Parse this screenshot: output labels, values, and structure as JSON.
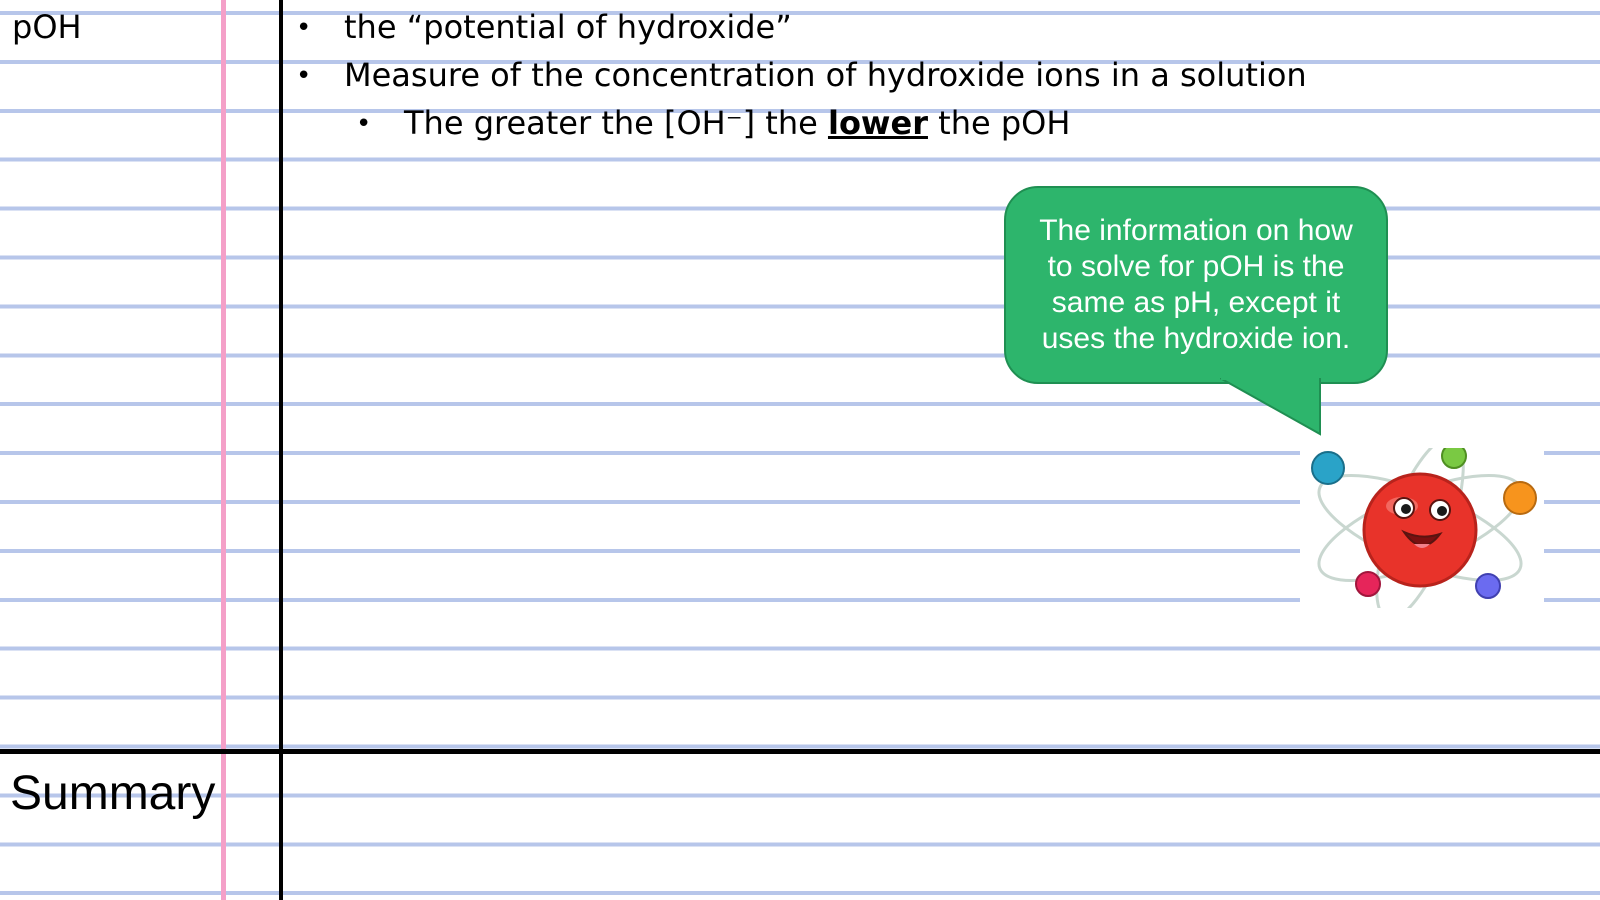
{
  "topic": "pOH",
  "bullets": [
    {
      "text": "the “potential of hydroxide”"
    },
    {
      "text": "Measure of the concentration of hydroxide ions in a solution"
    }
  ],
  "sub_bullet": {
    "prefix": "The greater the [OH⁻] the ",
    "emphasis": "lower",
    "suffix": " the pOH"
  },
  "callout": {
    "text": "The information on how to solve for pOH is the same as pH, except it uses the hydroxide ion."
  },
  "summary_label": "Summary",
  "colors": {
    "rule_lines": "#b7c6ea",
    "margin_line": "#f4a0c8",
    "callout_fill": "#2db56c",
    "atom_nucleus": "#e8332a"
  },
  "icons": {
    "mascot": "atom-mascot-icon"
  }
}
